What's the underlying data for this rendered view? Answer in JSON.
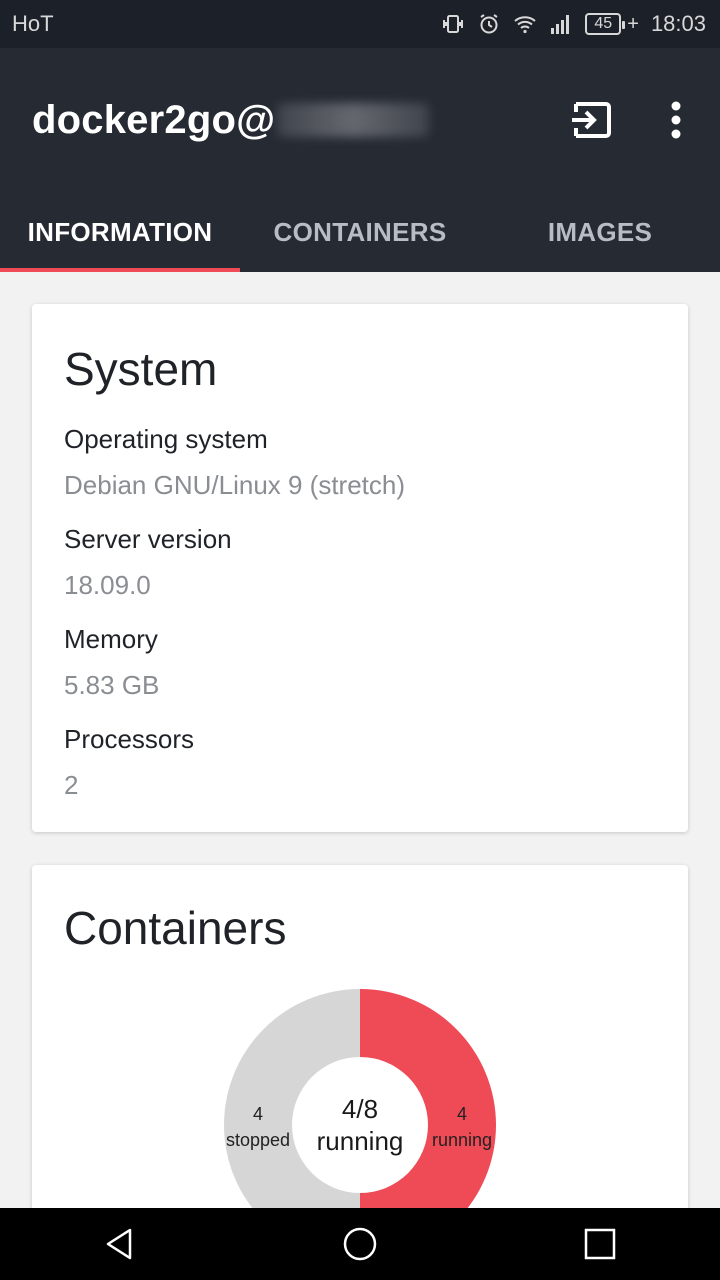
{
  "status_bar": {
    "carrier": "HoT",
    "battery": "45",
    "time": "18:03"
  },
  "app_bar": {
    "title": "docker2go@",
    "exit_icon": "exit-to-app-icon",
    "menu_icon": "more-vert-icon"
  },
  "tabs": [
    {
      "label": "INFORMATION",
      "active": true
    },
    {
      "label": "CONTAINERS",
      "active": false
    },
    {
      "label": "IMAGES",
      "active": false
    }
  ],
  "system": {
    "heading": "System",
    "fields": [
      {
        "label": "Operating system",
        "value": "Debian GNU/Linux 9 (stretch)"
      },
      {
        "label": "Server version",
        "value": "18.09.0"
      },
      {
        "label": "Memory",
        "value": "5.83 GB"
      },
      {
        "label": "Processors",
        "value": "2"
      }
    ]
  },
  "containers": {
    "heading": "Containers",
    "center_count": "4/8",
    "center_text": "running",
    "chart_data": {
      "type": "pie",
      "categories": [
        "stopped",
        "running"
      ],
      "values": [
        4,
        4
      ],
      "labels": [
        {
          "count": "4",
          "text": "stopped"
        },
        {
          "count": "4",
          "text": "running"
        }
      ],
      "colors": [
        "#d6d6d6",
        "#ef4b57"
      ]
    }
  },
  "colors": {
    "app_bar": "#252a33",
    "status_bar": "#1c2028",
    "accent": "#ef4b57",
    "stopped": "#d6d6d6"
  }
}
